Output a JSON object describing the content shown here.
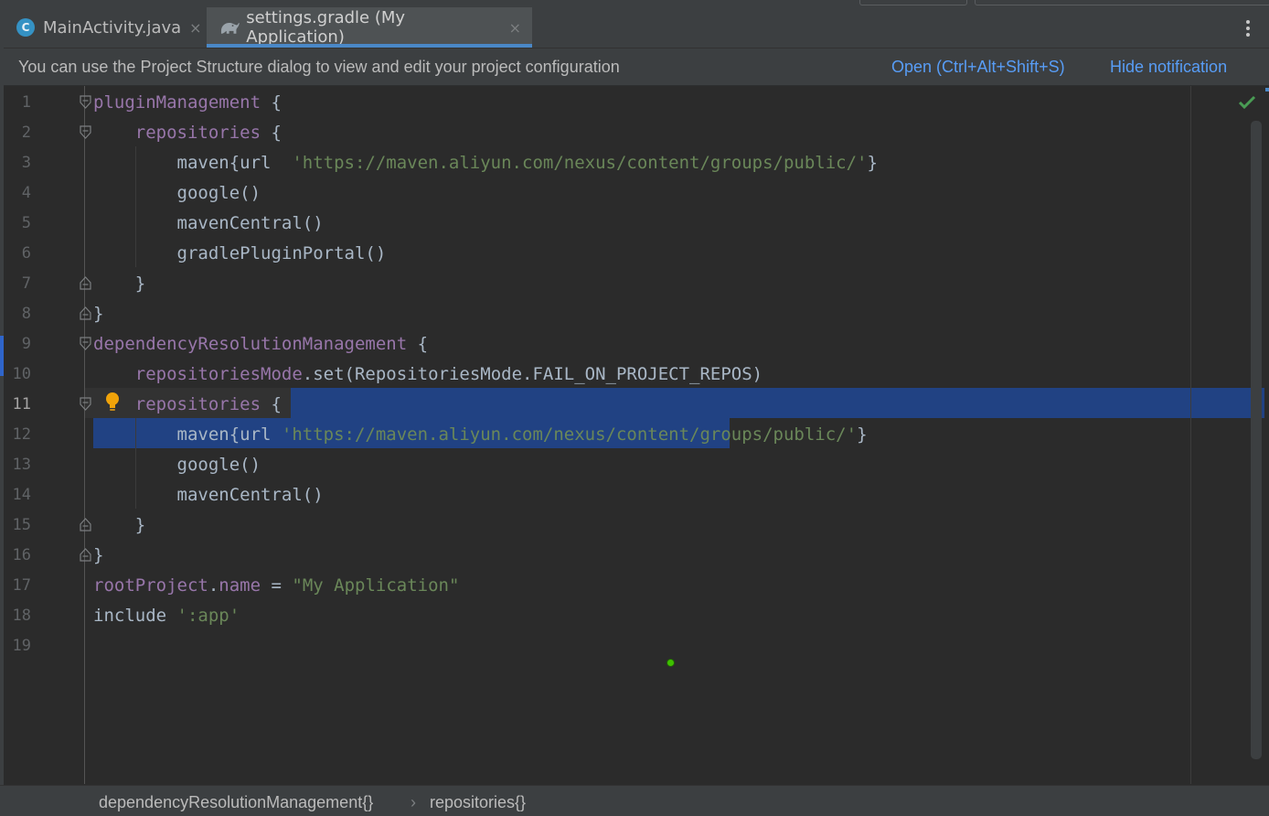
{
  "tabs": [
    {
      "label": "MainActivity.java",
      "icon": "java-class-icon",
      "icon_letter": "C",
      "active": false,
      "close": "×"
    },
    {
      "label": "settings.gradle (My Application)",
      "icon": "gradle-elephant-icon",
      "active": true,
      "close": "×"
    }
  ],
  "notification": {
    "message": "You can use the Project Structure dialog to view and edit your project configuration",
    "open_label": "Open (Ctrl+Alt+Shift+S)",
    "hide_label": "Hide notification"
  },
  "editor": {
    "current_line": 11,
    "line_numbers": [
      "1",
      "2",
      "3",
      "4",
      "5",
      "6",
      "7",
      "8",
      "9",
      "10",
      "11",
      "12",
      "13",
      "14",
      "15",
      "16",
      "17",
      "18",
      "19"
    ],
    "lines": [
      {
        "tokens": [
          {
            "t": "pluginManagement",
            "c": "m"
          },
          {
            "t": " {",
            "c": ""
          }
        ]
      },
      {
        "tokens": [
          {
            "t": "    ",
            "c": ""
          },
          {
            "t": "repositories",
            "c": "m"
          },
          {
            "t": " {",
            "c": ""
          }
        ]
      },
      {
        "tokens": [
          {
            "t": "        maven{url  ",
            "c": ""
          },
          {
            "t": "'https://maven.aliyun.com/nexus/content/groups/public/'",
            "c": "s"
          },
          {
            "t": "}",
            "c": ""
          }
        ]
      },
      {
        "tokens": [
          {
            "t": "        google()",
            "c": ""
          }
        ]
      },
      {
        "tokens": [
          {
            "t": "        mavenCentral()",
            "c": ""
          }
        ]
      },
      {
        "tokens": [
          {
            "t": "        gradlePluginPortal()",
            "c": ""
          }
        ]
      },
      {
        "tokens": [
          {
            "t": "    }",
            "c": ""
          }
        ]
      },
      {
        "tokens": [
          {
            "t": "}",
            "c": ""
          }
        ]
      },
      {
        "tokens": [
          {
            "t": "dependencyResolutionManagement",
            "c": "m"
          },
          {
            "t": " {",
            "c": ""
          }
        ]
      },
      {
        "tokens": [
          {
            "t": "    ",
            "c": ""
          },
          {
            "t": "repositoriesMode",
            "c": "m"
          },
          {
            "t": ".set(RepositoriesMode.FAIL_ON_PROJECT_REPOS)",
            "c": ""
          }
        ]
      },
      {
        "tokens": [
          {
            "t": "    ",
            "c": ""
          },
          {
            "t": "repositories",
            "c": "m"
          },
          {
            "t": " {",
            "c": ""
          }
        ]
      },
      {
        "tokens": [
          {
            "t": "        maven{url ",
            "c": ""
          },
          {
            "t": "'https://maven.aliyun.com/nexus/content/groups/public/'",
            "c": "s"
          },
          {
            "t": "}",
            "c": ""
          }
        ]
      },
      {
        "tokens": [
          {
            "t": "        google()",
            "c": ""
          }
        ]
      },
      {
        "tokens": [
          {
            "t": "        mavenCentral()",
            "c": ""
          }
        ]
      },
      {
        "tokens": [
          {
            "t": "    }",
            "c": ""
          }
        ]
      },
      {
        "tokens": [
          {
            "t": "}",
            "c": ""
          }
        ]
      },
      {
        "tokens": [
          {
            "t": "rootProject",
            "c": "m"
          },
          {
            "t": ".",
            "c": ""
          },
          {
            "t": "name",
            "c": "m"
          },
          {
            "t": " = ",
            "c": ""
          },
          {
            "t": "\"My Application\"",
            "c": "s"
          }
        ]
      },
      {
        "tokens": [
          {
            "t": "include ",
            "c": ""
          },
          {
            "t": "':app'",
            "c": "s"
          }
        ]
      },
      {
        "tokens": [
          {
            "t": "",
            "c": ""
          }
        ]
      }
    ]
  },
  "breadcrumbs": [
    "dependencyResolutionManagement{}",
    "repositories{}"
  ],
  "breadcrumb_separator": "›",
  "colors": {
    "background": "#2b2b2b",
    "keyword_property": "#9876aa",
    "string": "#6a8759",
    "plain": "#a9b7c6",
    "selection": "#214283",
    "link": "#589df6",
    "accent": "#4a88c7",
    "inspection_ok": "#499c54",
    "bulb": "#f0a30a"
  }
}
